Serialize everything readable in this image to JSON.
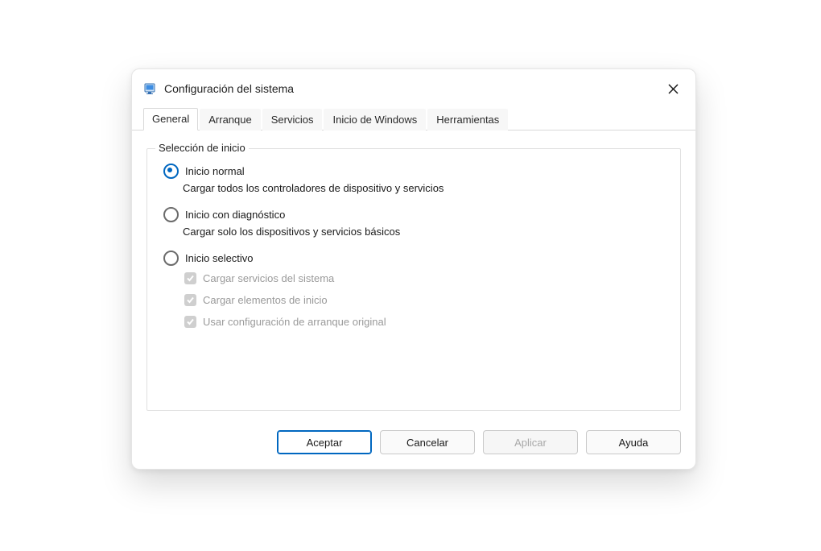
{
  "window": {
    "title": "Configuración del sistema"
  },
  "tabs": [
    {
      "label": "General",
      "active": true
    },
    {
      "label": "Arranque",
      "active": false
    },
    {
      "label": "Servicios",
      "active": false
    },
    {
      "label": "Inicio de Windows",
      "active": false
    },
    {
      "label": "Herramientas",
      "active": false
    }
  ],
  "group": {
    "legend": "Selección de inicio",
    "options": [
      {
        "label": "Inicio normal",
        "desc": "Cargar todos los controladores de dispositivo y servicios",
        "selected": true
      },
      {
        "label": "Inicio con diagnóstico",
        "desc": "Cargar solo los dispositivos y servicios básicos",
        "selected": false
      },
      {
        "label": "Inicio selectivo",
        "desc": "",
        "selected": false,
        "checkboxes": [
          {
            "label": "Cargar servicios del sistema",
            "checked": true,
            "disabled": true
          },
          {
            "label": "Cargar elementos de inicio",
            "checked": true,
            "disabled": true
          },
          {
            "label": "Usar configuración de arranque original",
            "checked": true,
            "disabled": true
          }
        ]
      }
    ]
  },
  "buttons": {
    "accept": "Aceptar",
    "cancel": "Cancelar",
    "apply": "Aplicar",
    "help": "Ayuda"
  }
}
